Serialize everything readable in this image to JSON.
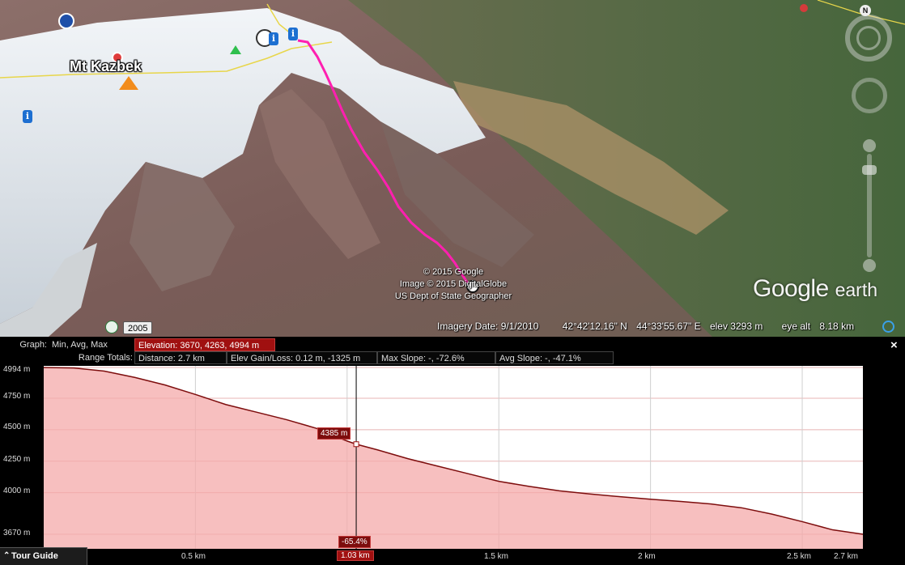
{
  "map": {
    "place_name": "Mt Kazbek",
    "copyright_lines": [
      "© 2015 Google",
      "Image © 2015 DigitalGlobe",
      "US Dept of State Geographer"
    ],
    "logo_main": "Google",
    "logo_sub": "earth",
    "historical_year": "2005",
    "north_label": "N",
    "info_glyph": "i"
  },
  "status": {
    "imagery_date": "Imagery Date: 9/1/2010",
    "latitude": "42°42'12.16\" N",
    "longitude": "44°33'55.67\" E",
    "elev": "elev  3293 m",
    "eye_alt_label": "eye alt",
    "eye_alt_value": "8.18 km"
  },
  "graph": {
    "header_row1_label": "Graph:",
    "header_row1_value": "Min, Avg, Max",
    "elevation_box": "Elevation: 3670, 4263, 4994 m",
    "header_row2_label": "Range Totals:",
    "distance_box": "Distance: 2.7 km",
    "gain_loss_box": "Elev Gain/Loss: 0.12 m, -1325 m",
    "max_slope_box": "Max Slope: -, -72.6%",
    "avg_slope_box": "Avg Slope: -, -47.1%",
    "close_glyph": "×",
    "cursor_elevation": "4385 m",
    "cursor_slope": "-65.4%",
    "cursor_distance": "1.03 km",
    "y_ticks": [
      "4994 m",
      "4750 m",
      "4500 m",
      "4250 m",
      "4000 m",
      "3670 m"
    ],
    "x_ticks": [
      "0.5 km",
      "1.5 km",
      "2 km",
      "2.5 km",
      "2.7 km"
    ],
    "tour_guide_label": "Tour Guide",
    "colors": {
      "accent": "#a01010",
      "line": "#7d0d0d",
      "fill": "#f4a9a9",
      "route": "#ff1fb0"
    }
  },
  "chart_data": {
    "type": "area",
    "xlabel": "",
    "ylabel": "",
    "x_unit": "km",
    "y_unit": "m",
    "xlim": [
      0,
      2.7
    ],
    "ylim": [
      3670,
      4994
    ],
    "x_ticks": [
      0.5,
      1.03,
      1.5,
      2,
      2.5,
      2.7
    ],
    "y_ticks": [
      3670,
      4000,
      4250,
      4500,
      4750,
      4994
    ],
    "grid": true,
    "series": [
      {
        "x": [
          0,
          0.1,
          0.2,
          0.3,
          0.4,
          0.5,
          0.6,
          0.7,
          0.8,
          0.9,
          1.0,
          1.03,
          1.1,
          1.2,
          1.3,
          1.4,
          1.5,
          1.6,
          1.7,
          1.8,
          1.9,
          2.0,
          2.1,
          2.2,
          2.3,
          2.4,
          2.5,
          2.6,
          2.7
        ],
        "y": [
          4994,
          4990,
          4965,
          4915,
          4855,
          4780,
          4700,
          4640,
          4580,
          4510,
          4410,
          4385,
          4340,
          4270,
          4210,
          4150,
          4090,
          4050,
          4015,
          3990,
          3968,
          3948,
          3930,
          3910,
          3880,
          3830,
          3770,
          3705,
          3670
        ]
      }
    ],
    "cursor": {
      "x": 1.03,
      "y": 4385,
      "slope": "-65.4%"
    }
  }
}
